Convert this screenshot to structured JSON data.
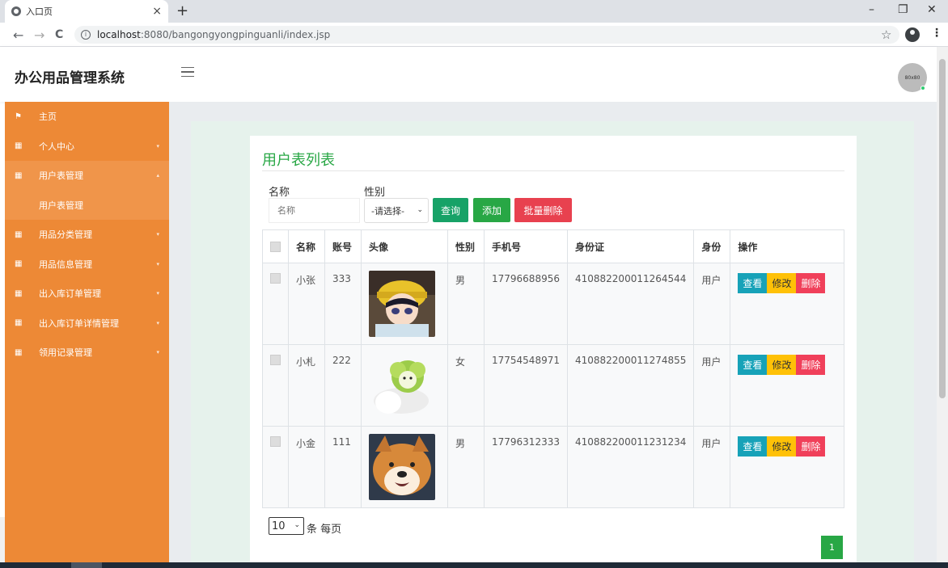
{
  "browser": {
    "tab_title": "入口页",
    "close_glyph": "×",
    "new_tab_glyph": "+",
    "url_host": "localhost",
    "url_rest": ":8080/bangongyongpinguanli/index.jsp",
    "info_glyph": "i",
    "window_controls": {
      "minimize": "–",
      "restore": "❐",
      "close": "✕"
    },
    "nav": {
      "back": "←",
      "forward": "→",
      "reload": "C"
    },
    "star_glyph": "☆",
    "menu_glyph": "⋮"
  },
  "header": {
    "brand": "办公用品管理系统",
    "avatar_text": "80x80"
  },
  "sidebar": {
    "items": [
      {
        "label": "主页",
        "icon": "flag-icon",
        "glyph": "⚑"
      },
      {
        "label": "个人中心",
        "icon": "grid-icon",
        "glyph": "▦"
      },
      {
        "label": "用户表管理",
        "icon": "grid-icon",
        "glyph": "▦"
      },
      {
        "label": "用户表管理"
      },
      {
        "label": "用品分类管理",
        "icon": "grid-icon",
        "glyph": "▦"
      },
      {
        "label": "用品信息管理",
        "icon": "grid-icon",
        "glyph": "▦"
      },
      {
        "label": "出入库订单管理",
        "icon": "grid-icon",
        "glyph": "▦"
      },
      {
        "label": "出入库订单详情管理",
        "icon": "grid-icon",
        "glyph": "▦"
      },
      {
        "label": "领用记录管理",
        "icon": "grid-icon",
        "glyph": "▦"
      }
    ],
    "chevron_down": "▾",
    "chevron_up": "▴"
  },
  "main": {
    "title": "用户表列表",
    "filters": {
      "name_label": "名称",
      "name_placeholder": "名称",
      "gender_label": "性别",
      "gender_selected": "-请选择-",
      "select_arrow": "⌄"
    },
    "buttons": {
      "query": "查询",
      "add": "添加",
      "batch_delete": "批量删除"
    },
    "table": {
      "headers": [
        "名称",
        "账号",
        "头像",
        "性别",
        "手机号",
        "身份证",
        "身份",
        "操作"
      ],
      "rows": [
        {
          "name": "小张",
          "account": "333",
          "avatar": "anime-boy-avatar",
          "gender": "男",
          "phone": "17796688956",
          "id_card": "410882200011264544",
          "role": "用户"
        },
        {
          "name": "小札",
          "account": "222",
          "avatar": "cabbage-dog-avatar",
          "gender": "女",
          "phone": "17754548971",
          "id_card": "410882200011274855",
          "role": "用户"
        },
        {
          "name": "小金",
          "account": "111",
          "avatar": "shiba-dog-avatar",
          "gender": "男",
          "phone": "17796312333",
          "id_card": "410882200011231234",
          "role": "用户"
        }
      ],
      "actions": {
        "view": "查看",
        "edit": "修改",
        "delete": "删除"
      }
    },
    "pagination": {
      "page_size": "10",
      "per_page_label": "条 每页",
      "current_page": "1"
    }
  },
  "colors": {
    "sidebar": "#ed8936",
    "accent_green": "#28a745",
    "info": "#17a2b8",
    "warning": "#ffc107",
    "danger": "#dc3545"
  }
}
